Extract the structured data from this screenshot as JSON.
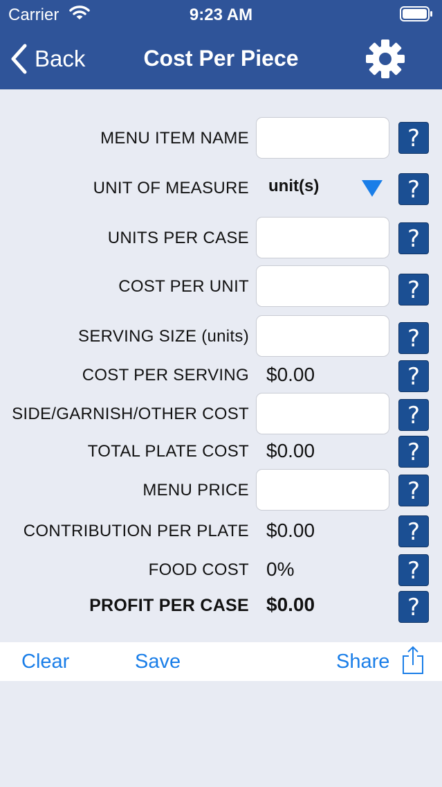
{
  "status": {
    "carrier": "Carrier",
    "time": "9:23 AM"
  },
  "nav": {
    "back_label": "Back",
    "title": "Cost Per Piece"
  },
  "form": {
    "menu_item_name": {
      "label": "MENU ITEM NAME",
      "value": ""
    },
    "unit_of_measure": {
      "label": "UNIT OF MEASURE",
      "value": "unit(s)"
    },
    "units_per_case": {
      "label": "UNITS PER CASE",
      "value": ""
    },
    "cost_per_unit": {
      "label": "COST PER UNIT",
      "value": ""
    },
    "serving_size": {
      "label": "SERVING SIZE (units)",
      "value": ""
    },
    "cost_per_serving": {
      "label": "COST PER SERVING",
      "value": "$0.00"
    },
    "side_cost": {
      "label": "SIDE/GARNISH/OTHER COST",
      "value": ""
    },
    "total_plate_cost": {
      "label": "TOTAL PLATE COST",
      "value": "$0.00"
    },
    "menu_price": {
      "label": "MENU PRICE",
      "value": ""
    },
    "contribution_per_plate": {
      "label": "CONTRIBUTION PER PLATE",
      "value": "$0.00"
    },
    "food_cost": {
      "label": "FOOD COST",
      "value": "0%"
    },
    "profit_per_case": {
      "label": "PROFIT PER CASE",
      "value": "$0.00"
    }
  },
  "help_glyph": "?",
  "bottom": {
    "clear": "Clear",
    "save": "Save",
    "share": "Share"
  },
  "icons": {
    "back": "chevron-left-icon",
    "settings": "gear-icon",
    "dropdown": "triangle-down-icon",
    "share": "share-icon",
    "wifi": "wifi-icon",
    "battery": "battery-icon"
  },
  "colors": {
    "navbar": "#2f5499",
    "background": "#e8ebf3",
    "help_button": "#1b4f93",
    "accent": "#1a7ee8"
  }
}
